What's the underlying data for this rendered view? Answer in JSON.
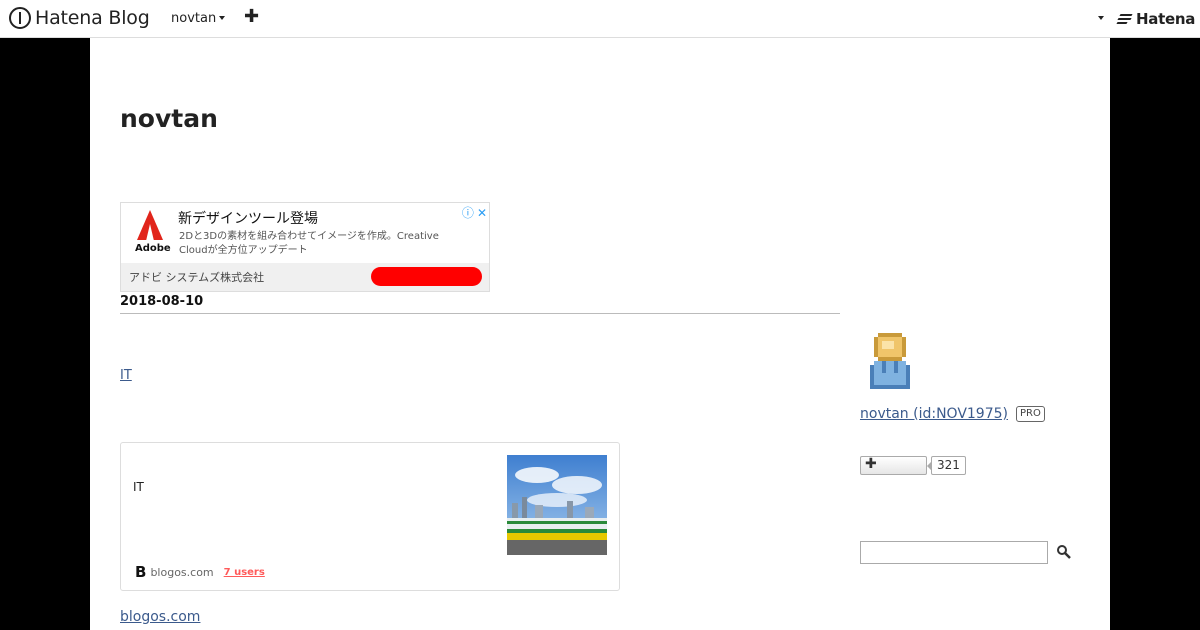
{
  "header": {
    "brand": "Hatena Blog",
    "user": "novtan",
    "add_label": "✚",
    "right_brand": "Hatena"
  },
  "blog": {
    "title": "novtan"
  },
  "ad": {
    "logo_text": "Adobe",
    "headline": "新デザインツール登場",
    "body": "2Dと3Dの素材を組み合わせてイメージを作成。Creative Cloudが全方位アップデート",
    "company": "アドビ システムズ株式会社",
    "info_icon": "ⓘ",
    "close_icon": "✕",
    "button_color": "#ff0000"
  },
  "entry": {
    "date": "2018-08-10",
    "category": "IT",
    "card": {
      "title": "IT",
      "site_icon": "B",
      "domain": "blogos.com",
      "users": "7 users"
    },
    "source_link": "blogos.com"
  },
  "sidebar": {
    "profile_name": "novtan (id:NOV1975)",
    "pro_label": "PRO",
    "star_icon": "✚",
    "star_count": "321",
    "search_placeholder": ""
  },
  "colors": {
    "link": "#3b5a8c",
    "users": "#ff5a5a",
    "adobe_red": "#e1251b"
  }
}
